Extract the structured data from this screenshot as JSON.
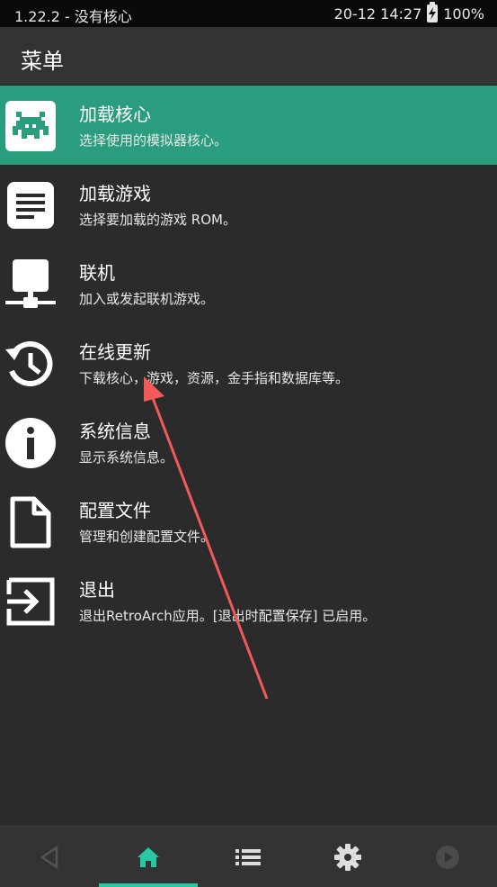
{
  "status_bar": {
    "left_text": "1.22.2 - 没有核心",
    "time": "20-12 14:27",
    "battery": "100%"
  },
  "app_bar": {
    "title": "菜单"
  },
  "menu_items": [
    {
      "label": "加载核心",
      "sub": "选择使用的模拟器核心。",
      "icon": "retroarch-invader-icon",
      "selected": true
    },
    {
      "label": "加载游戏",
      "sub": "选择要加载的游戏 ROM。",
      "icon": "document-lines-icon"
    },
    {
      "label": "联机",
      "sub": "加入或发起联机游戏。",
      "icon": "network-icon"
    },
    {
      "label": "在线更新",
      "sub": "下载核心，游戏，资源，金手指和数据库等。",
      "icon": "history-update-icon"
    },
    {
      "label": "系统信息",
      "sub": "显示系统信息。",
      "icon": "info-icon"
    },
    {
      "label": "配置文件",
      "sub": "管理和创建配置文件。",
      "icon": "file-icon"
    },
    {
      "label": "退出",
      "sub": "退出RetroArch应用。[退出时配置保存] 已启用。",
      "icon": "exit-icon"
    }
  ],
  "bottom_tabs": [
    {
      "icon": "back-icon"
    },
    {
      "icon": "home-icon",
      "active": true
    },
    {
      "icon": "list-icon"
    },
    {
      "icon": "settings-icon"
    },
    {
      "icon": "play-icon"
    }
  ],
  "colors": {
    "accent": "#2a9d7e",
    "active_tab": "#27c9a4",
    "background": "#2b2b2b",
    "annotation": "#f25a5a"
  }
}
